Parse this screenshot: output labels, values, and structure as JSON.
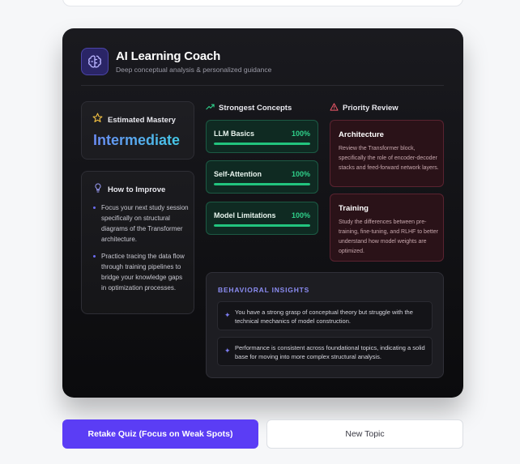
{
  "header": {
    "title": "AI Learning Coach",
    "subtitle": "Deep conceptual analysis & personalized guidance"
  },
  "mastery": {
    "label": "Estimated Mastery",
    "value": "Intermediate"
  },
  "improve": {
    "label": "How to Improve",
    "items": [
      "Focus your next study session specifically on structural diagrams of the Transformer architecture.",
      "Practice tracing the data flow through training pipelines to bridge your knowledge gaps in optimization processes."
    ]
  },
  "strongest": {
    "heading": "Strongest Concepts",
    "items": [
      {
        "name": "LLM Basics",
        "percent_label": "100%",
        "percent": 100
      },
      {
        "name": "Self-Attention",
        "percent_label": "100%",
        "percent": 100
      },
      {
        "name": "Model Limitations",
        "percent_label": "100%",
        "percent": 100
      }
    ]
  },
  "priority": {
    "heading": "Priority Review",
    "items": [
      {
        "title": "Architecture",
        "text": "Review the Transformer block, specifically the role of encoder-decoder stacks and feed-forward network layers."
      },
      {
        "title": "Training",
        "text": "Study the differences between pre-training, fine-tuning, and RLHF to better understand how model weights are optimized."
      }
    ]
  },
  "insights": {
    "title": "BEHAVIORAL INSIGHTS",
    "items": [
      "You have a strong grasp of conceptual theory but struggle with the technical mechanics of model construction.",
      "Performance is consistent across foundational topics, indicating a solid base for moving into more complex structural analysis."
    ]
  },
  "actions": {
    "retake_label": "Retake Quiz (Focus on Weak Spots)",
    "new_topic_label": "New Topic"
  },
  "colors": {
    "accent": "#5b3df5",
    "success": "#22c47e",
    "danger": "#5a2330"
  },
  "icons": {
    "header": "brain-icon",
    "mastery": "star-icon",
    "improve": "lightbulb-icon",
    "strongest": "trending-up-icon",
    "priority": "alert-triangle-icon",
    "insight": "sparkle-icon"
  }
}
